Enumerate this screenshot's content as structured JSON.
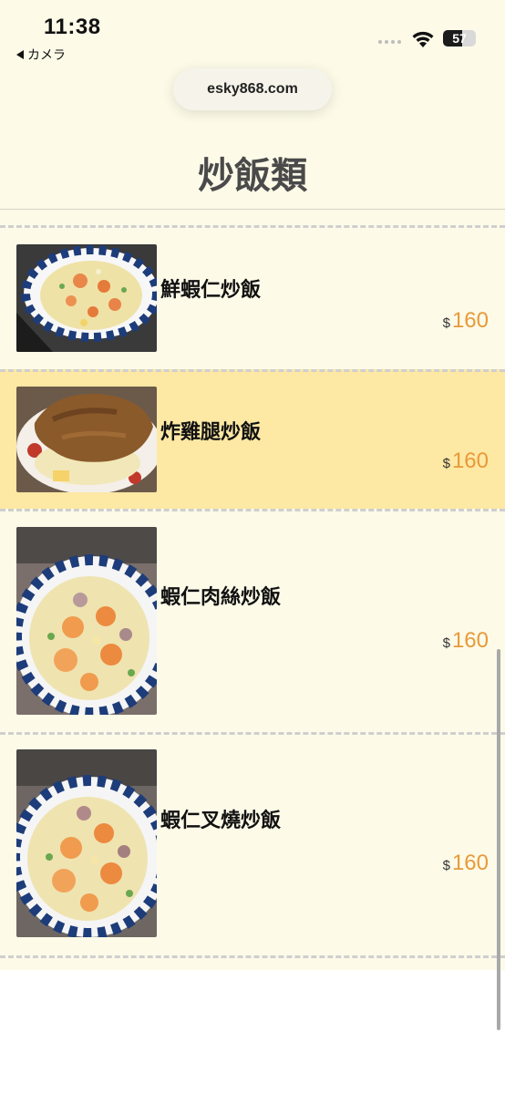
{
  "status_bar": {
    "time": "11:38",
    "back_label": "カメラ",
    "battery": "57",
    "battery_level": 0.57
  },
  "browser": {
    "url": "esky868.com"
  },
  "page": {
    "title": "炒飯類"
  },
  "currency_symbol": "$",
  "items": [
    {
      "name": "鮮蝦仁炒飯",
      "price": "160",
      "highlighted": false
    },
    {
      "name": "炸雞腿炒飯",
      "price": "160",
      "highlighted": true
    },
    {
      "name": "蝦仁肉絲炒飯",
      "price": "160",
      "highlighted": false
    },
    {
      "name": "蝦仁叉燒炒飯",
      "price": "160",
      "highlighted": false
    }
  ],
  "colors": {
    "background": "#fdfae8",
    "highlight": "#fde8a4",
    "price": "#e89a3a",
    "divider": "#cfcfcf"
  },
  "icons": [
    "back-arrow-icon",
    "signal-icon",
    "wifi-icon",
    "battery-icon"
  ]
}
